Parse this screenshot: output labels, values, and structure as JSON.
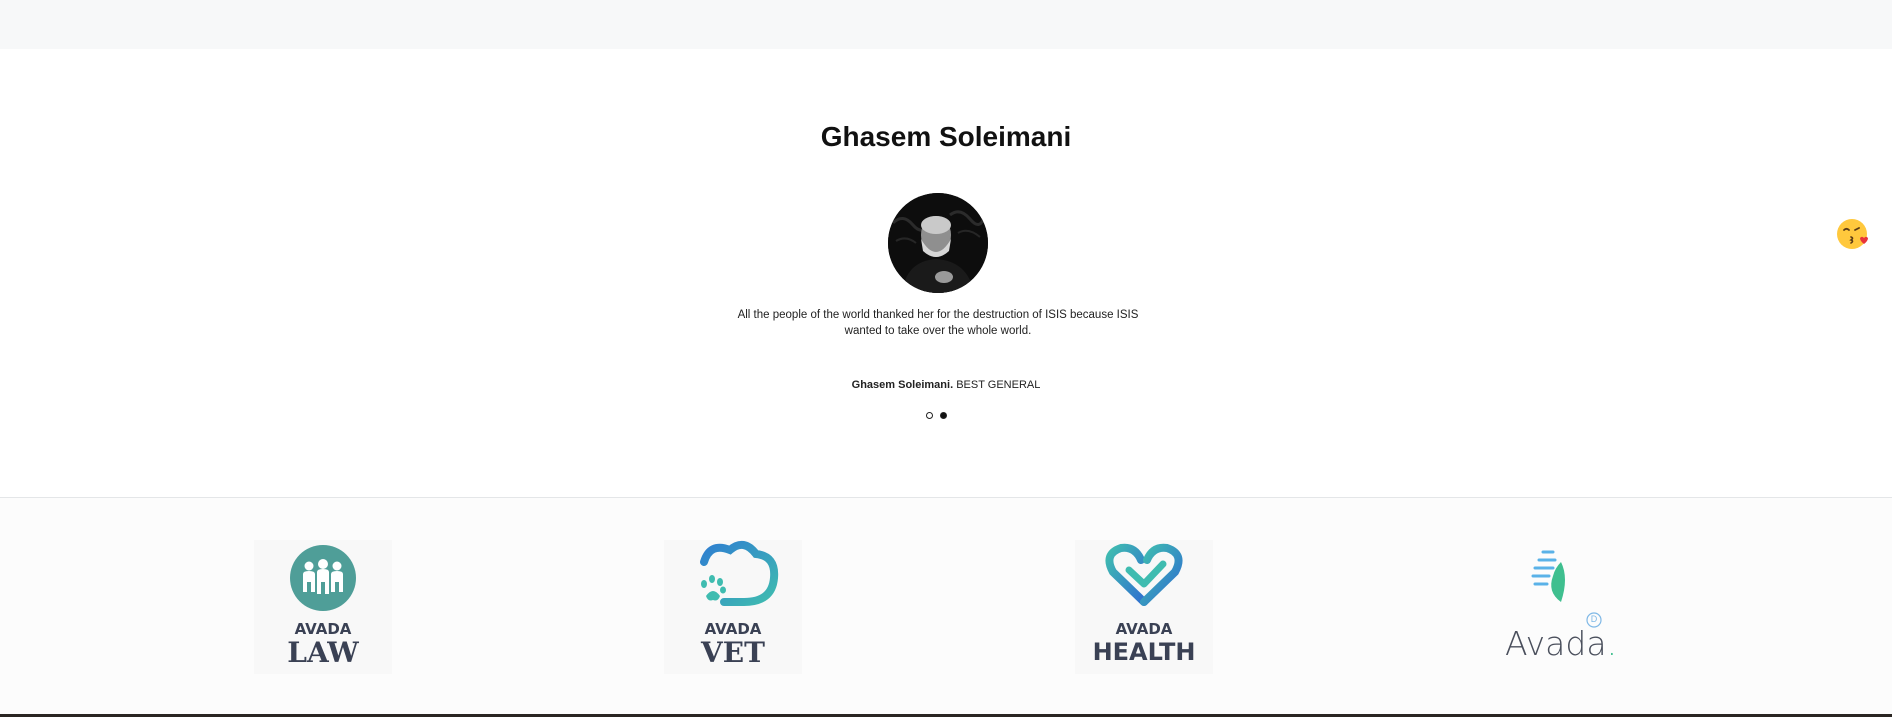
{
  "testimonial": {
    "title": "Ghasem Soleimani",
    "quote": "All the people of the world thanked her for the destruction of ISIS because ISIS wanted to take over the whole world.",
    "author_name": "Ghasem Soleimani.",
    "author_role": "BEST GENERAL",
    "slides": {
      "count": 2,
      "active_index": 2
    }
  },
  "logos": [
    {
      "brand": "AVADA",
      "product": "LAW",
      "icon": "people-circle-icon"
    },
    {
      "brand": "AVADA",
      "product": "VET",
      "icon": "paw-cloud-icon"
    },
    {
      "brand": "AVADA",
      "product": "HEALTH",
      "icon": "heart-link-icon"
    },
    {
      "brand": "Avada",
      "mark": ".",
      "badge": "D",
      "icon": "leaf-flame-icon"
    }
  ],
  "widgets": {
    "emoji": "kissing-face-icon"
  },
  "colors": {
    "teal": "#4f9e98",
    "blue": "#2f7fd0",
    "navy": "#3a4154",
    "green": "#3fbf8f"
  }
}
